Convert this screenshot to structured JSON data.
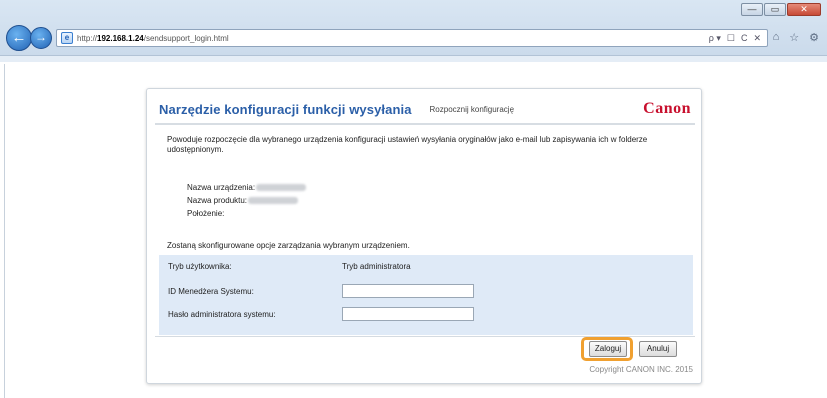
{
  "browser": {
    "url_scheme": "http://",
    "url_host": "192.168.1.24",
    "url_path": "/sendsupport_login.html",
    "address_icons": [
      "ρ ▾",
      "☐",
      "C",
      "✕"
    ],
    "toolbar_icons": [
      "⌂",
      "☆",
      "⚙"
    ],
    "window_controls": [
      "—",
      "▭",
      "✕"
    ]
  },
  "panel": {
    "title": "Narzędzie konfiguracji funkcji wysyłania",
    "subtitle": "Rozpocznij konfigurację",
    "logo": "Canon",
    "description": "Powoduje rozpoczęcie dla wybranego urządzenia konfiguracji ustawień wysyłania oryginałów jako e-mail lub zapisywania ich w folderze udostępnionym.",
    "info": {
      "device_name_label": "Nazwa urządzenia:",
      "product_name_label": "Nazwa produktu:",
      "location_label": "Położenie:"
    },
    "note": "Zostaną skonfigurowane opcje zarządzania wybranym urządzeniem.",
    "login": {
      "user_mode_label": "Tryb użytkownika:",
      "user_mode_value": "Tryb administratora",
      "system_manager_id_label": "ID Menedżera Systemu:",
      "system_manager_id_value": "",
      "admin_password_label": "Hasło administratora systemu:",
      "admin_password_value": ""
    },
    "buttons": {
      "login": "Zaloguj",
      "cancel": "Anuluj"
    },
    "copyright": "Copyright CANON INC. 2015"
  }
}
